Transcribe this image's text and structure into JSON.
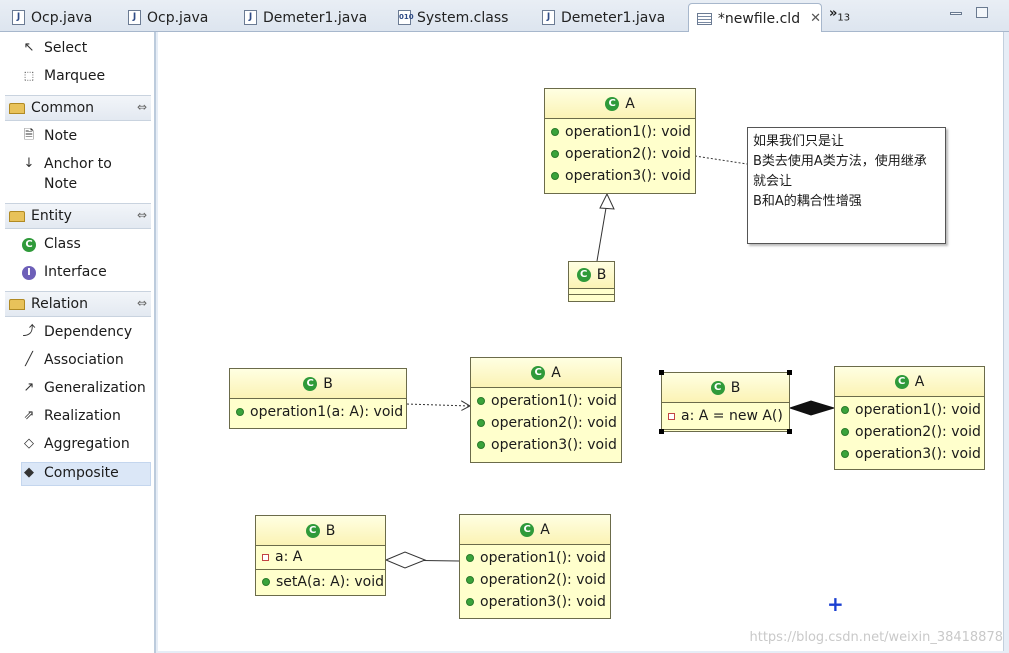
{
  "tabs": [
    {
      "label": "Ocp.java",
      "icon": "java-file-icon"
    },
    {
      "label": "Ocp.java",
      "icon": "java-file-icon"
    },
    {
      "label": "Demeter1.java",
      "icon": "java-file-icon"
    },
    {
      "label": "System.class",
      "icon": "class-file-icon"
    },
    {
      "label": "Demeter1.java",
      "icon": "java-file-icon"
    },
    {
      "label": "*newfile.cld",
      "icon": "class-diagram-icon",
      "active": true
    }
  ],
  "tab_overflow": {
    "symbol": "»",
    "count": "13"
  },
  "palette": {
    "tools": [
      {
        "label": "Select",
        "icon": "select-arrow-icon"
      },
      {
        "label": "Marquee",
        "icon": "marquee-icon"
      }
    ],
    "drawers": [
      {
        "label": "Common",
        "items": [
          {
            "label": "Note",
            "icon": "note-icon"
          },
          {
            "label": "Anchor to",
            "label2": "Note",
            "icon": "anchor-icon"
          }
        ]
      },
      {
        "label": "Entity",
        "items": [
          {
            "label": "Class",
            "icon": "class-icon"
          },
          {
            "label": "Interface",
            "icon": "interface-icon"
          }
        ]
      },
      {
        "label": "Relation",
        "items": [
          {
            "label": "Dependency",
            "icon": "dependency-icon"
          },
          {
            "label": "Association",
            "icon": "association-icon"
          },
          {
            "label": "Generalization",
            "icon": "generalization-icon"
          },
          {
            "label": "Realization",
            "icon": "realization-icon"
          },
          {
            "label": "Aggregation",
            "icon": "aggregation-icon"
          },
          {
            "label": "Composite",
            "icon": "composite-icon",
            "selected": true
          }
        ]
      }
    ]
  },
  "diagram": {
    "a1": {
      "name": "A",
      "ops": [
        "operation1(): void",
        "operation2(): void",
        "operation3(): void"
      ]
    },
    "b1": {
      "name": "B"
    },
    "note": {
      "lines": [
        "如果我们只是让",
        "B类去使用A类方法，使用继承",
        "就会让",
        "B和A的耦合性增强"
      ]
    },
    "b2": {
      "name": "B",
      "ops": [
        "operation1(a: A): void"
      ]
    },
    "a2": {
      "name": "A",
      "ops": [
        "operation1(): void",
        "operation2(): void",
        "operation3(): void"
      ]
    },
    "b3": {
      "name": "B",
      "fields": [
        "a: A = new A()"
      ]
    },
    "a3": {
      "name": "A",
      "ops": [
        "operation1(): void",
        "operation2(): void",
        "operation3(): void"
      ]
    },
    "b4": {
      "name": "B",
      "fields": [
        "a: A"
      ],
      "ops": [
        "setA(a: A): void"
      ]
    },
    "a4": {
      "name": "A",
      "ops": [
        "operation1(): void",
        "operation2(): void",
        "operation3(): void"
      ]
    }
  },
  "cursor": "+",
  "watermark": "https://blog.csdn.net/weixin_38418878",
  "colors": {
    "class_fill": "#ffffcc",
    "accent": "#2f9a3a",
    "selection": "#dbe7f7"
  }
}
